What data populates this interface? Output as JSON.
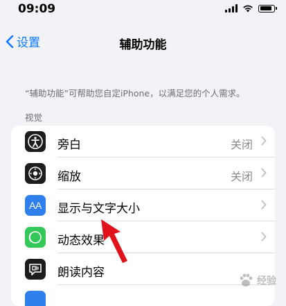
{
  "status_bar": {
    "time": "09:09"
  },
  "nav": {
    "back_label": "设置",
    "title": "辅助功能"
  },
  "description": "“辅助功能”可帮助您自定iPhone，以满足您的个人需求。",
  "section": {
    "header": "视觉",
    "items": [
      {
        "label": "旁白",
        "value": "关闭",
        "icon": "voiceover-icon",
        "icon_color": "#1c1c1e"
      },
      {
        "label": "缩放",
        "value": "关闭",
        "icon": "zoom-icon",
        "icon_color": "#1c1c1e"
      },
      {
        "label": "显示与文字大小",
        "value": "",
        "icon": "text-size-icon",
        "icon_color": "#2f80ed"
      },
      {
        "label": "动态效果",
        "value": "",
        "icon": "motion-icon",
        "icon_color": "#34c759"
      },
      {
        "label": "朗读内容",
        "value": "",
        "icon": "spoken-content-icon",
        "icon_color": "#1c1c1e"
      }
    ]
  },
  "icons": {
    "text_size_glyph": "AA"
  },
  "watermark": {
    "text": "经验"
  },
  "colors": {
    "accent": "#0a7aff",
    "annotation_arrow": "#e0121b"
  }
}
